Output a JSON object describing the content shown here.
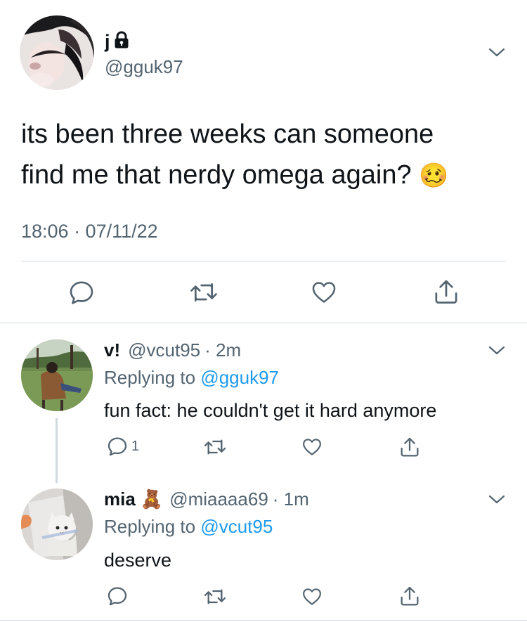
{
  "main_tweet": {
    "display_name": "j",
    "handle": "@gguk97",
    "text_line1": "its been three weeks can someone",
    "text_line2": "find me that nerdy omega again?",
    "emoji": "🥴",
    "timestamp": "18:06 · 07/11/22"
  },
  "replies": [
    {
      "display_name": "v!",
      "handle": "@vcut95",
      "time": "· 2m",
      "replying_prefix": "Replying to",
      "replying_to": "@gguk97",
      "text": "fun fact: he couldn't get it hard anymore",
      "reply_count": "1"
    },
    {
      "display_name": "mia",
      "name_emoji": "🧸",
      "handle": "@miaaaa69",
      "time": "· 1m",
      "replying_prefix": "Replying to",
      "replying_to": "@vcut95",
      "text": "deserve"
    }
  ],
  "icons": {
    "locked": "lock-icon",
    "caret": "chevron-down-icon",
    "reply": "reply-icon",
    "retweet": "retweet-icon",
    "like": "heart-icon",
    "share": "share-icon"
  },
  "colors": {
    "text": "#0f1419",
    "secondary": "#536471",
    "link": "#1d9bf0",
    "divider": "#cfd9de"
  }
}
